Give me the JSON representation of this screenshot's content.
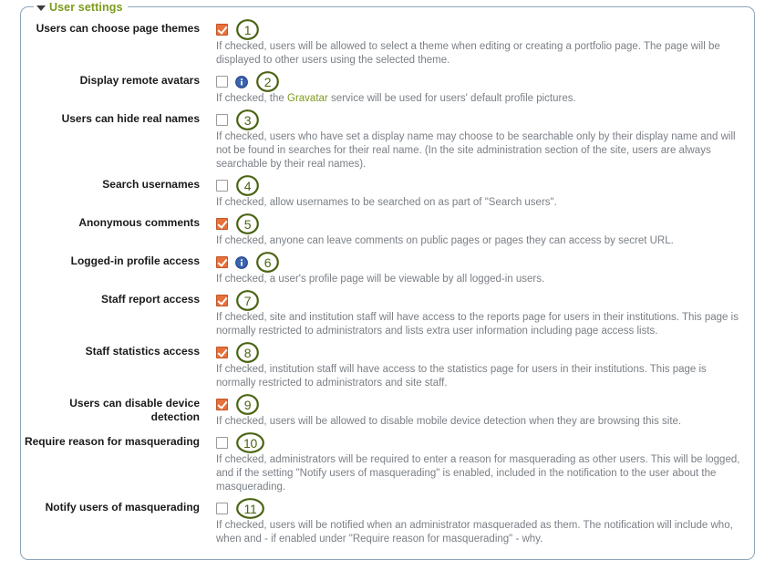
{
  "fieldset": {
    "legend": "User settings",
    "caret_icon": "triangle-down-icon",
    "accent_color": "#7d9a1d",
    "border_color": "#8ea4ba",
    "checked_color": "#e8703a",
    "annotation_color": "#4a6312"
  },
  "settings": [
    {
      "number": "1",
      "label": "Users can choose page themes",
      "checked": true,
      "info": false,
      "description": "If checked, users will be allowed to select a theme when editing or creating a portfolio page. The page will be displayed to other users using the selected theme."
    },
    {
      "number": "2",
      "label": "Display remote avatars",
      "checked": false,
      "info": true,
      "description_before": "If checked, the ",
      "link": "Gravatar",
      "description_after": " service will be used for users' default profile pictures."
    },
    {
      "number": "3",
      "label": "Users can hide real names",
      "checked": false,
      "info": false,
      "description": "If checked, users who have set a display name may choose to be searchable only by their display name and will not be found in searches for their real name. (In the site administration section of the site, users are always searchable by their real names)."
    },
    {
      "number": "4",
      "label": "Search usernames",
      "checked": false,
      "info": false,
      "description": "If checked, allow usernames to be searched on as part of \"Search users\"."
    },
    {
      "number": "5",
      "label": "Anonymous comments",
      "checked": true,
      "info": false,
      "description": "If checked, anyone can leave comments on public pages or pages they can access by secret URL."
    },
    {
      "number": "6",
      "label": "Logged-in profile access",
      "checked": true,
      "info": true,
      "description": "If checked, a user's profile page will be viewable by all logged-in users."
    },
    {
      "number": "7",
      "label": "Staff report access",
      "checked": true,
      "info": false,
      "description": "If checked, site and institution staff will have access to the reports page for users in their institutions. This page is normally restricted to administrators and lists extra user information including page access lists."
    },
    {
      "number": "8",
      "label": "Staff statistics access",
      "checked": true,
      "info": false,
      "description": "If checked, institution staff will have access to the statistics page for users in their institutions. This page is normally restricted to administrators and site staff."
    },
    {
      "number": "9",
      "label": "Users can disable device detection",
      "checked": true,
      "info": false,
      "description": "If checked, users will be allowed to disable mobile device detection when they are browsing this site."
    },
    {
      "number": "10",
      "label": "Require reason for masquerading",
      "checked": false,
      "info": false,
      "description": "If checked, administrators will be required to enter a reason for masquerading as other users. This will be logged, and if the setting \"Notify users of masquerading\" is enabled, included in the notification to the user about the masquerading."
    },
    {
      "number": "11",
      "label": "Notify users of masquerading",
      "checked": false,
      "info": false,
      "description": "If checked, users will be notified when an administrator masqueraded as them. The notification will include who, when and - if enabled under \"Require reason for masquerading\" - why."
    }
  ]
}
